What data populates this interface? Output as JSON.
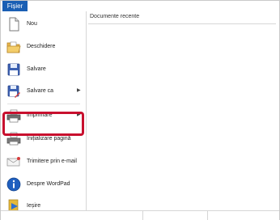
{
  "menubar": {
    "file_tab": "Fișier"
  },
  "menu": {
    "items": [
      {
        "label": "Nou",
        "icon": "new-document-icon",
        "submenu": false
      },
      {
        "label": "Deschidere",
        "icon": "open-folder-icon",
        "submenu": false
      },
      {
        "label": "Salvare",
        "icon": "save-floppy-icon",
        "submenu": false
      },
      {
        "label": "Salvare ca",
        "icon": "save-as-icon",
        "submenu": true
      },
      {
        "label": "Imprimare",
        "icon": "printer-icon",
        "submenu": true,
        "highlighted": true
      },
      {
        "label": "Inițializare pagină",
        "icon": "page-setup-icon",
        "submenu": false
      },
      {
        "label": "Trimitere prin e-mail",
        "icon": "email-icon",
        "submenu": false
      },
      {
        "label": "Despre WordPad",
        "icon": "info-icon",
        "submenu": false
      },
      {
        "label": "Ieșire",
        "icon": "exit-icon",
        "submenu": false
      }
    ],
    "submenu_arrow": "▶"
  },
  "recent": {
    "title": "Documente recente"
  },
  "colors": {
    "accent": "#1a5fb4",
    "highlight": "#c8102e"
  }
}
